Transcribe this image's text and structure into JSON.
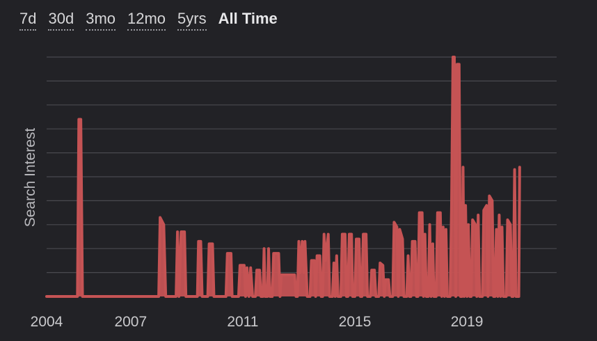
{
  "range_tabs": [
    {
      "label": "7d",
      "active": false
    },
    {
      "label": "30d",
      "active": false
    },
    {
      "label": "3mo",
      "active": false
    },
    {
      "label": "12mo",
      "active": false
    },
    {
      "label": "5yrs",
      "active": false
    },
    {
      "label": "All Time",
      "active": true
    }
  ],
  "colors": {
    "background": "#222226",
    "series": "#c55354",
    "grid": "#4a4a4f",
    "text": "#c9c9cc"
  },
  "chart_data": {
    "type": "area",
    "title": "",
    "xlabel": "",
    "ylabel": "Search Interest",
    "x_tick_labels": [
      "2004",
      "2007",
      "2011",
      "2015",
      "2019"
    ],
    "x_tick_values": [
      2004.0,
      2007.0,
      2011.0,
      2015.0,
      2019.0
    ],
    "xlim": [
      2004.0,
      2022.2
    ],
    "ylim": [
      0,
      100
    ],
    "y_gridlines": [
      10,
      20,
      30,
      40,
      50,
      60,
      70,
      80,
      90,
      100
    ],
    "grid": true,
    "legend": "none",
    "series": [
      {
        "name": "",
        "points": [
          [
            2004.0,
            0
          ],
          [
            2005.1,
            0
          ],
          [
            2005.15,
            74
          ],
          [
            2005.22,
            74
          ],
          [
            2005.28,
            0
          ],
          [
            2008.0,
            0
          ],
          [
            2008.05,
            33
          ],
          [
            2008.18,
            30
          ],
          [
            2008.25,
            0
          ],
          [
            2008.62,
            0
          ],
          [
            2008.67,
            27
          ],
          [
            2008.72,
            0
          ],
          [
            2008.8,
            27
          ],
          [
            2008.92,
            27
          ],
          [
            2008.97,
            0
          ],
          [
            2009.38,
            0
          ],
          [
            2009.42,
            23
          ],
          [
            2009.5,
            23
          ],
          [
            2009.55,
            0
          ],
          [
            2009.75,
            0
          ],
          [
            2009.8,
            22
          ],
          [
            2009.92,
            22
          ],
          [
            2009.97,
            0
          ],
          [
            2010.4,
            0
          ],
          [
            2010.45,
            18
          ],
          [
            2010.58,
            18
          ],
          [
            2010.62,
            0
          ],
          [
            2010.85,
            0
          ],
          [
            2010.9,
            13
          ],
          [
            2011.05,
            13
          ],
          [
            2011.1,
            0
          ],
          [
            2011.15,
            12
          ],
          [
            2011.22,
            0
          ],
          [
            2011.28,
            12
          ],
          [
            2011.35,
            0
          ],
          [
            2011.45,
            0
          ],
          [
            2011.5,
            11
          ],
          [
            2011.6,
            11
          ],
          [
            2011.65,
            0
          ],
          [
            2011.72,
            0
          ],
          [
            2011.76,
            20
          ],
          [
            2011.8,
            0
          ],
          [
            2011.88,
            0
          ],
          [
            2011.92,
            20
          ],
          [
            2011.97,
            0
          ],
          [
            2012.05,
            0
          ],
          [
            2012.1,
            18
          ],
          [
            2012.28,
            18
          ],
          [
            2012.33,
            0
          ],
          [
            2012.38,
            9
          ],
          [
            2012.85,
            9
          ],
          [
            2012.9,
            0
          ],
          [
            2012.95,
            0
          ],
          [
            2013.0,
            23
          ],
          [
            2013.05,
            10
          ],
          [
            2013.12,
            23
          ],
          [
            2013.18,
            10
          ],
          [
            2013.22,
            23
          ],
          [
            2013.3,
            0
          ],
          [
            2013.4,
            0
          ],
          [
            2013.45,
            15
          ],
          [
            2013.55,
            15
          ],
          [
            2013.6,
            0
          ],
          [
            2013.65,
            17
          ],
          [
            2013.75,
            17
          ],
          [
            2013.8,
            0
          ],
          [
            2013.85,
            0
          ],
          [
            2013.9,
            26
          ],
          [
            2013.95,
            15
          ],
          [
            2014.05,
            26
          ],
          [
            2014.1,
            0
          ],
          [
            2014.2,
            0
          ],
          [
            2014.25,
            14
          ],
          [
            2014.3,
            0
          ],
          [
            2014.35,
            17
          ],
          [
            2014.4,
            0
          ],
          [
            2014.5,
            0
          ],
          [
            2014.55,
            26
          ],
          [
            2014.65,
            26
          ],
          [
            2014.7,
            0
          ],
          [
            2014.75,
            0
          ],
          [
            2014.8,
            26
          ],
          [
            2014.88,
            26
          ],
          [
            2014.92,
            0
          ],
          [
            2015.0,
            0
          ],
          [
            2015.05,
            24
          ],
          [
            2015.15,
            24
          ],
          [
            2015.2,
            0
          ],
          [
            2015.25,
            0
          ],
          [
            2015.3,
            26
          ],
          [
            2015.4,
            26
          ],
          [
            2015.45,
            0
          ],
          [
            2015.55,
            0
          ],
          [
            2015.6,
            11
          ],
          [
            2015.7,
            11
          ],
          [
            2015.75,
            0
          ],
          [
            2015.85,
            0
          ],
          [
            2015.9,
            14
          ],
          [
            2016.0,
            13
          ],
          [
            2016.05,
            0
          ],
          [
            2016.1,
            7
          ],
          [
            2016.2,
            7
          ],
          [
            2016.25,
            0
          ],
          [
            2016.35,
            0
          ],
          [
            2016.4,
            31
          ],
          [
            2016.5,
            29
          ],
          [
            2016.55,
            0
          ],
          [
            2016.6,
            28
          ],
          [
            2016.7,
            24
          ],
          [
            2016.75,
            0
          ],
          [
            2016.85,
            0
          ],
          [
            2016.9,
            17
          ],
          [
            2016.95,
            0
          ],
          [
            2017.0,
            0
          ],
          [
            2017.05,
            23
          ],
          [
            2017.15,
            23
          ],
          [
            2017.2,
            0
          ],
          [
            2017.25,
            0
          ],
          [
            2017.3,
            35
          ],
          [
            2017.4,
            35
          ],
          [
            2017.45,
            0
          ],
          [
            2017.5,
            26
          ],
          [
            2017.55,
            0
          ],
          [
            2017.62,
            0
          ],
          [
            2017.67,
            30
          ],
          [
            2017.72,
            0
          ],
          [
            2017.78,
            22
          ],
          [
            2017.82,
            0
          ],
          [
            2017.9,
            0
          ],
          [
            2017.95,
            35
          ],
          [
            2018.05,
            35
          ],
          [
            2018.1,
            0
          ],
          [
            2018.15,
            29
          ],
          [
            2018.2,
            0
          ],
          [
            2018.25,
            28
          ],
          [
            2018.3,
            0
          ],
          [
            2018.4,
            0
          ],
          [
            2018.45,
            38
          ],
          [
            2018.5,
            100
          ],
          [
            2018.55,
            100
          ],
          [
            2018.6,
            0
          ],
          [
            2018.65,
            97
          ],
          [
            2018.72,
            97
          ],
          [
            2018.77,
            0
          ],
          [
            2018.82,
            0
          ],
          [
            2018.86,
            54
          ],
          [
            2018.9,
            0
          ],
          [
            2018.95,
            38
          ],
          [
            2019.0,
            0
          ],
          [
            2019.05,
            30
          ],
          [
            2019.1,
            0
          ],
          [
            2019.15,
            0
          ],
          [
            2019.2,
            32
          ],
          [
            2019.3,
            30
          ],
          [
            2019.35,
            0
          ],
          [
            2019.4,
            34
          ],
          [
            2019.45,
            0
          ],
          [
            2019.55,
            0
          ],
          [
            2019.6,
            36
          ],
          [
            2019.7,
            38
          ],
          [
            2019.75,
            0
          ],
          [
            2019.8,
            42
          ],
          [
            2019.9,
            40
          ],
          [
            2019.95,
            0
          ],
          [
            2020.0,
            0
          ],
          [
            2020.05,
            28
          ],
          [
            2020.1,
            0
          ],
          [
            2020.15,
            34
          ],
          [
            2020.2,
            0
          ],
          [
            2020.25,
            29
          ],
          [
            2020.3,
            0
          ],
          [
            2020.4,
            0
          ],
          [
            2020.45,
            32
          ],
          [
            2020.55,
            30
          ],
          [
            2020.6,
            0
          ],
          [
            2020.65,
            0
          ],
          [
            2020.7,
            53
          ],
          [
            2020.75,
            0
          ],
          [
            2020.8,
            0
          ],
          [
            2020.85,
            0
          ],
          [
            2020.88,
            54
          ]
        ]
      }
    ]
  }
}
